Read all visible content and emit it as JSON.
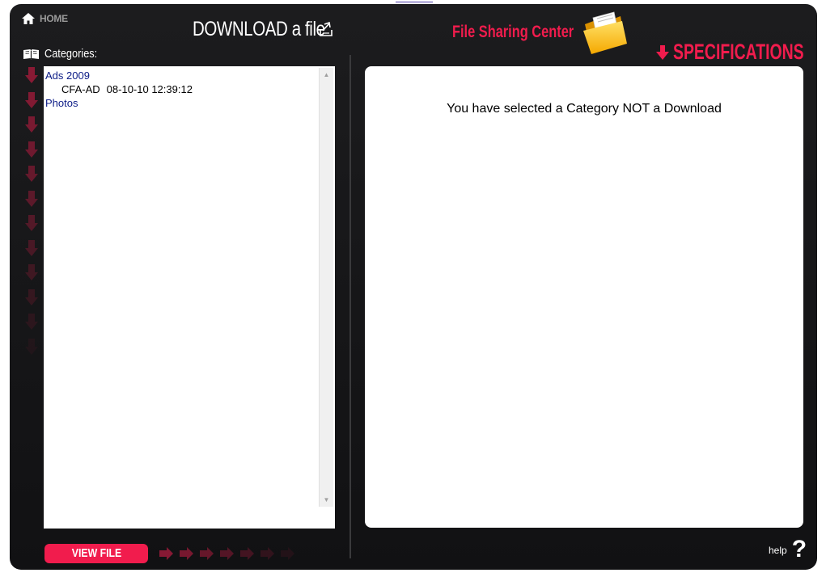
{
  "home": {
    "label": "HOME"
  },
  "page_title": "DOWNLOAD a file",
  "categories": {
    "label": "Categories:"
  },
  "tree": [
    {
      "type": "category",
      "label": "Ads 2009"
    },
    {
      "type": "file",
      "name": "CFA-AD",
      "timestamp": "08-10-10 12:39:12"
    },
    {
      "type": "category",
      "label": "Photos"
    }
  ],
  "brand": {
    "title": "File Sharing Center"
  },
  "specifications": {
    "label": "SPECIFICATIONS",
    "message": "You have selected a Category NOT a Download"
  },
  "footer": {
    "view_file_label": "VIEW FILE",
    "help_label": "help",
    "help_mark": "?"
  },
  "colors": {
    "accent": "#f11c4d",
    "background": "#1a1a1c",
    "category_link": "#0b1b86"
  },
  "icons": [
    "home-icon",
    "download-icon",
    "book-icon",
    "folder-icon",
    "down-arrow-icon",
    "right-arrow-icon",
    "help-icon"
  ]
}
